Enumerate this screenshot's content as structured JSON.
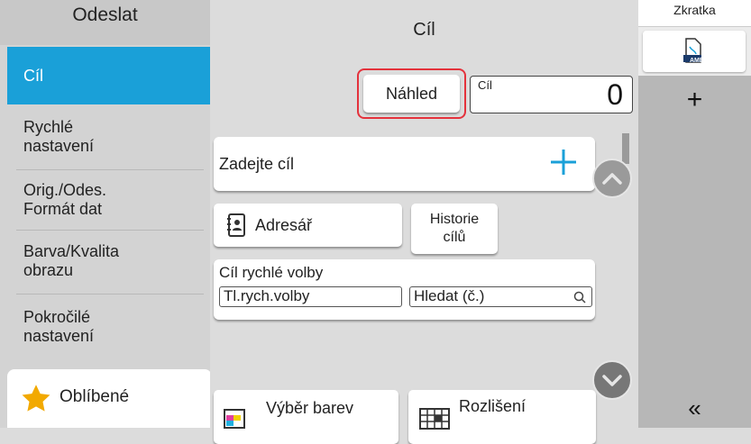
{
  "sidebar": {
    "title": "Odeslat",
    "items": [
      {
        "label": "Cíl"
      },
      {
        "label": "Rychlé\nnastavení"
      },
      {
        "label": "Orig./Odes.\nFormát dat"
      },
      {
        "label": "Barva/Kvalita\nobrazu"
      },
      {
        "label": "Pokročilé\nnastavení"
      }
    ],
    "favorites_label": "Oblíbené"
  },
  "main": {
    "title": "Cíl",
    "preview_button": "Náhled",
    "dest_label": "Cíl",
    "dest_count": "0",
    "enter_dest": "Zadejte cíl",
    "address_book": "Adresář",
    "history": "Historie\ncílů",
    "speed_dial_title": "Cíl rychlé volby",
    "speed_dial_button": "Tl.rych.volby",
    "search_no": "Hledat (č.)",
    "color_select": "Výběr barev",
    "resolution": "Rozlišení"
  },
  "rightbar": {
    "shortcut_title": "Zkratka",
    "shortcut_badge": "AME",
    "add_symbol": "+",
    "collapse_symbol": "«"
  },
  "colors": {
    "accent": "#1aa0d8",
    "highlight": "#e4323c",
    "favorite_star": "#f2a900"
  }
}
